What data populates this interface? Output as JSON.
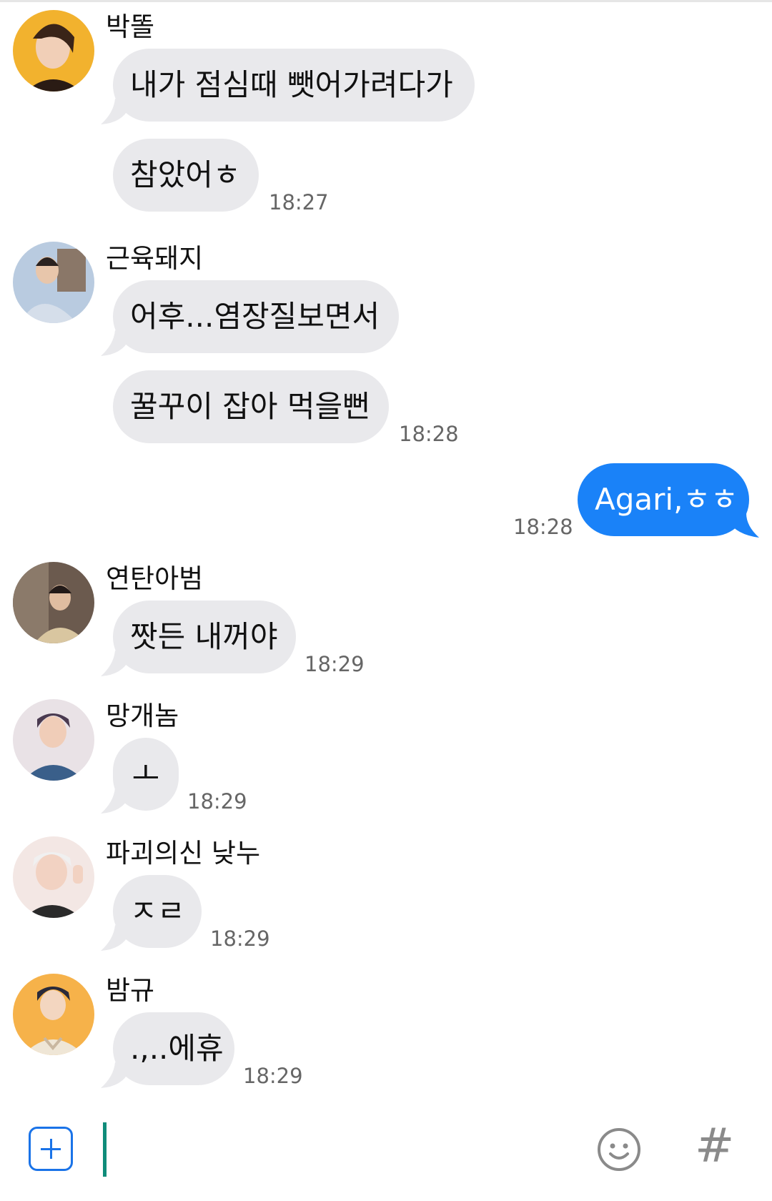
{
  "messages": [
    {
      "sender": "박똘",
      "bubbles": [
        "내가 점심때 뺏어가려다가",
        "참았어ㅎ"
      ],
      "time": "18:27"
    },
    {
      "sender": "근육돼지",
      "bubbles": [
        "어후...염장질보면서",
        "꿀꾸이 잡아 먹을뻔"
      ],
      "time": "18:28"
    },
    {
      "sender": "me",
      "bubbles": [
        "Agari,ㅎㅎ"
      ],
      "time": "18:28"
    },
    {
      "sender": "연탄아범",
      "bubbles": [
        "짯든 내꺼야"
      ],
      "time": "18:29"
    },
    {
      "sender": "망개놈",
      "bubbles": [
        "ㅗ"
      ],
      "time": "18:29"
    },
    {
      "sender": "파괴의신 낮누",
      "bubbles": [
        "ㅈㄹ"
      ],
      "time": "18:29"
    },
    {
      "sender": "밤규",
      "bubbles": [
        ".,..에휴"
      ],
      "time": "18:29"
    }
  ],
  "composer": {
    "add_icon": "plus-square-icon",
    "emoji_icon": "smile-icon",
    "hashtag_icon": "hash-icon",
    "hashtag_glyph": "#",
    "input_value": ""
  },
  "colors": {
    "me_bubble": "#1a82f8",
    "other_bubble": "#e9e9ec",
    "accent": "#0f8c7a"
  }
}
